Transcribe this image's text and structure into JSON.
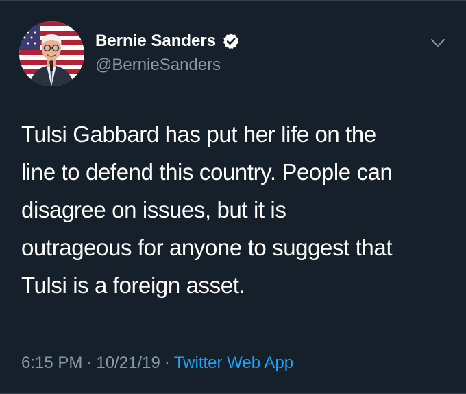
{
  "tweet": {
    "display_name": "Bernie Sanders",
    "handle": "@BernieSanders",
    "verified": true,
    "text_lines": [
      "Tulsi Gabbard has put her life on the",
      "line to defend this country. People can",
      "disagree on issues, but it is",
      "outrageous for anyone to suggest that",
      "Tulsi is a foreign asset."
    ],
    "time": "6:15 PM",
    "separator": "·",
    "date": "10/21/19",
    "source": "Twitter Web App"
  },
  "icons": {
    "verified": "verified-badge-icon",
    "caret": "chevron-down-icon",
    "avatar": "avatar"
  },
  "colors": {
    "background": "#15202b",
    "primary_text": "#ffffff",
    "secondary_text": "#8899a6",
    "link": "#1da1f2",
    "border": "#38444d"
  }
}
